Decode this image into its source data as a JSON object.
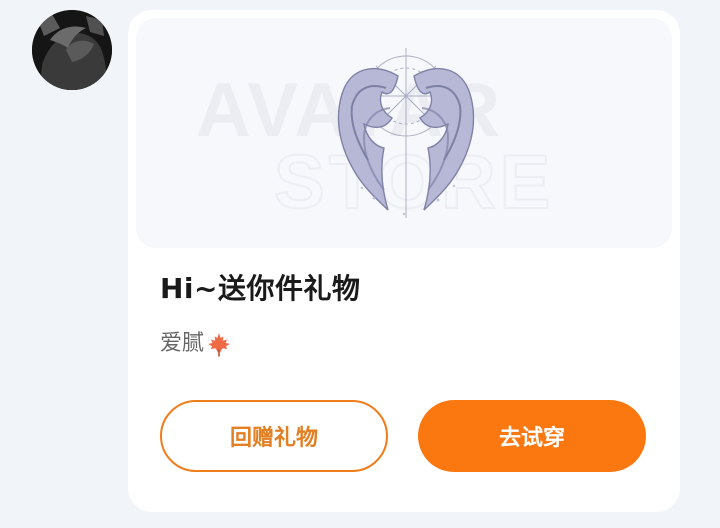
{
  "avatar": {
    "alt": "user avatar"
  },
  "banner": {
    "watermark_line1": "AVATAR",
    "watermark_line2": "STORE",
    "image_name": "wings-icon"
  },
  "gift": {
    "title": "Hi~送你件礼物",
    "sender_name": "爱腻",
    "sender_icon": "maple-leaf-icon"
  },
  "buttons": {
    "return_gift": "回赠礼物",
    "try_on": "去试穿"
  },
  "colors": {
    "accent": "#fb770f",
    "outline": "#ef7d1a",
    "background": "#f1f4f8"
  }
}
